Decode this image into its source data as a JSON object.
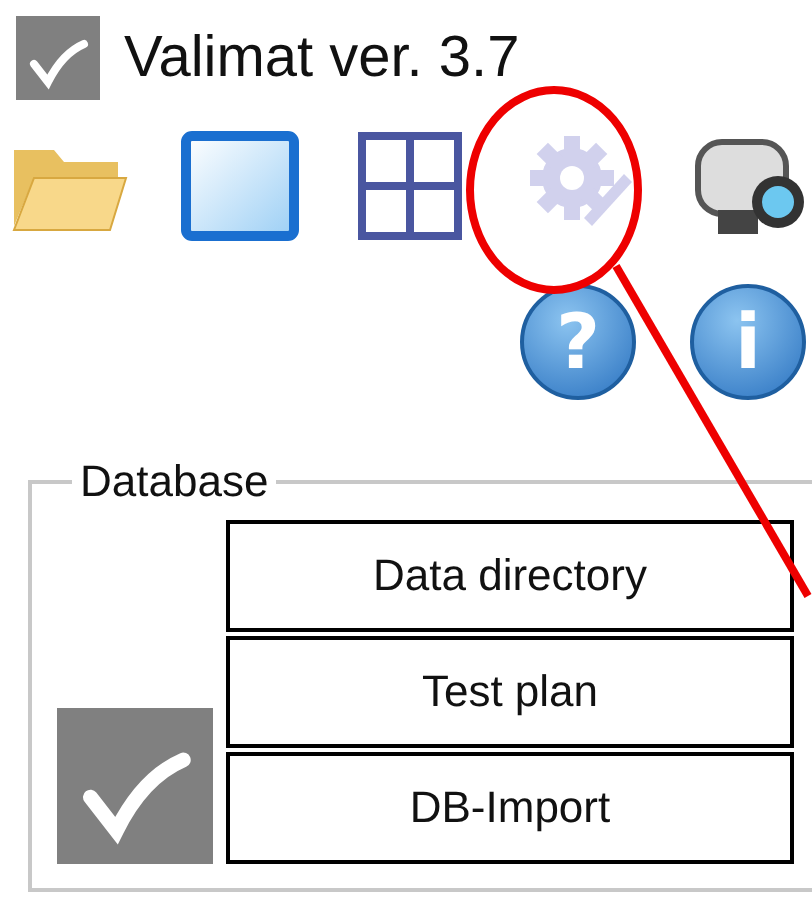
{
  "window": {
    "title": "Valimat ver. 3.7"
  },
  "toolbar": [
    {
      "kind": "folder",
      "disabled": false
    },
    {
      "kind": "window",
      "disabled": false
    },
    {
      "kind": "grid",
      "disabled": false
    },
    {
      "kind": "settings",
      "disabled": true
    },
    {
      "kind": "camera",
      "disabled": false
    }
  ],
  "help_buttons": [
    {
      "label": "?"
    },
    {
      "label": "i"
    }
  ],
  "database": {
    "label": "Database",
    "buttons": [
      "Data directory",
      "Test plan",
      "DB-Import"
    ]
  }
}
